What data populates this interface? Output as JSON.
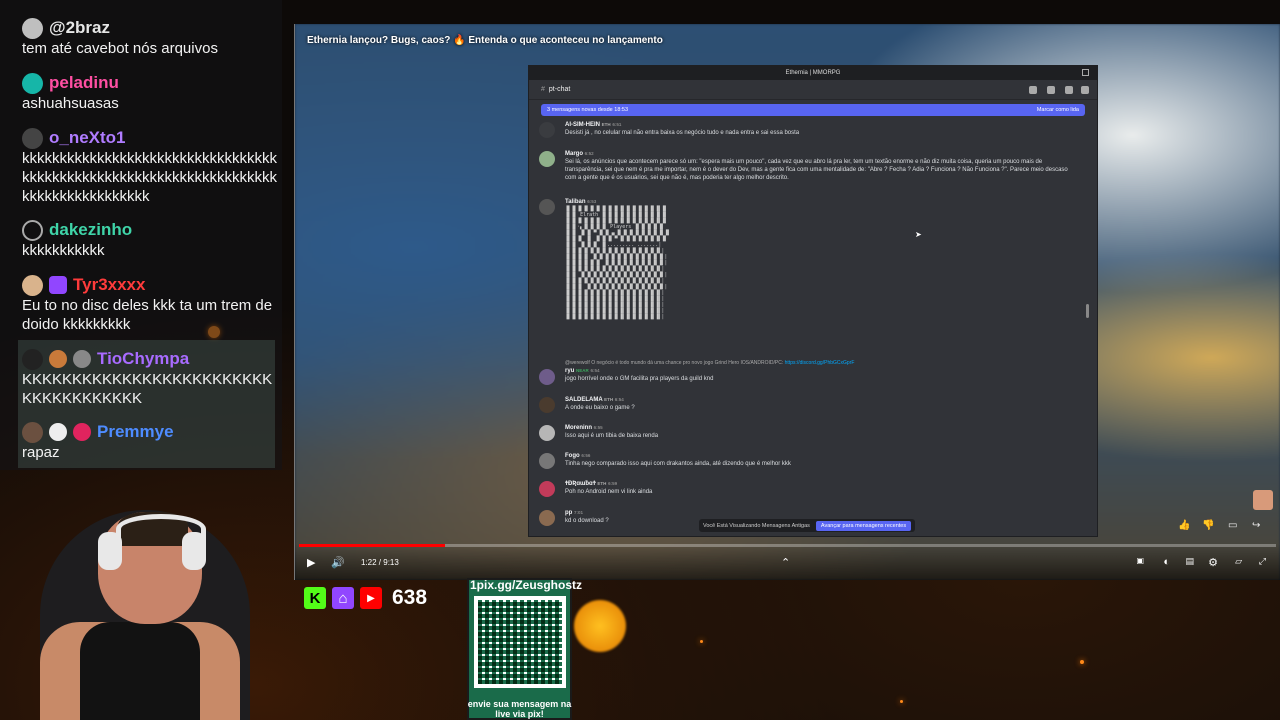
{
  "chat": {
    "messages": [
      {
        "user": "@2braz",
        "text": "tem até cavebot nós arquivos",
        "color": "#e6e6e6"
      },
      {
        "user": "peladinu",
        "text": "ashuahsuasas",
        "color": "#ff4fa3"
      },
      {
        "user": "o_neXto1",
        "text": "kkkkkkkkkkkkkkkkkkkkkkkkkkkkkkkkkkkkkkkkkkkkkkkkkkkkkkkkkkkkkkkkkkkkkkkkkkkkkkkkkkkkk",
        "color": "#b07cff"
      },
      {
        "user": "dakezinho",
        "text": "kkkkkkkkkkk",
        "color": "#3fd4a8"
      },
      {
        "user": "Tyr3xxxx",
        "text": "Eu to no disc deles kkk ta um trem de doido kkkkkkkkk",
        "color": "#ff3b3b"
      },
      {
        "user": "TioChympa",
        "text": "KKKKKKKKKKKKKKKKKKKKKKKKKKKKKKKKKKKKK",
        "color": "#a86bff"
      },
      {
        "user": "Premmye",
        "text": "rapaz",
        "color": "#4e8cff"
      }
    ]
  },
  "video": {
    "title": "Ethernia lançou? Bugs, caos? 🔥 Entenda o que aconteceu no lançamento",
    "time": "1:22 / 9:13",
    "progress": 0.149
  },
  "discord": {
    "window_title": "Ethernia | MMORPG",
    "channel": "pt-chat",
    "new_messages": "3 mensagens novas desde 18:53",
    "mark_read": "Marcar como lida",
    "messages": [
      {
        "name": "AI-SIM-HEIN",
        "tag": "ETH",
        "time": "6:51",
        "text": "Desisti já , no celular mal não entra baixa os negócio tudo e nada entra e sai essa bosta"
      },
      {
        "name": "Margo",
        "time": "6:52",
        "text": "Sei lá, os anúncios que acontecem parece só um: \"espera mais um pouco\", cada vez que eu abro lá pra ler, tem um textão enorme e não diz muita coisa, queria um pouco mais de transparência, sei que nem é pra me importar, nem é o dever do Dev, mas a gente fica com uma mentalidade de: \"Abre ? Fecha ? Adia ? Funciona ? Não Funciona ?\". Parece meio descaso com a gente que é os usuários, sei que não é, mas poderia ter algo melhor descrito."
      },
      {
        "name": "Taliban",
        "time": "6:53",
        "text": ""
      },
      {
        "name": "ryu",
        "tag": "NEAR",
        "time": "6:54",
        "reply": "@werewolf O negócio é todo mundo dá uma chance pro novo jogo Grind Hero IOS/ANDROID/PC:",
        "link": "https://discord.gg/PhbGCxGprF",
        "text": "jogo horrível onde o GM facilita pra players da guild knd"
      },
      {
        "name": "SALDELAMA",
        "tag": "ETH",
        "time": "6:54",
        "text": "A onde eu baixo o game ?"
      },
      {
        "name": "Moreninn",
        "time": "6:55",
        "text": "Isso aqui é um tibia de baixa renda"
      },
      {
        "name": "Fogo",
        "time": "6:56",
        "text": "Tinha nego comparado isso aqui com drakantos ainda, até dizendo que é melhor  kkk"
      },
      {
        "name": "ϮĐƦɑɯƀɑϮ",
        "tag": "ETH",
        "time": "6:59",
        "text": "Poh no Android nem vi link ainda"
      },
      {
        "name": "pp",
        "time": "7:01",
        "text": "kd o download ?"
      }
    ],
    "ascii_labels": [
      "Elrath",
      "Players"
    ],
    "old_messages": "Você Está Visualizando Mensagens Antigas",
    "jump": "Avançar para mensagens recentes"
  },
  "social": {
    "count": "638"
  },
  "pix": {
    "url": "1pix.gg/Zeusghostz",
    "caption": "envie sua mensagem na live via pix!"
  },
  "colors": {
    "discord_accent": "#5865f2",
    "youtube_red": "#ff0000",
    "pix_green": "#1a6b4a"
  }
}
